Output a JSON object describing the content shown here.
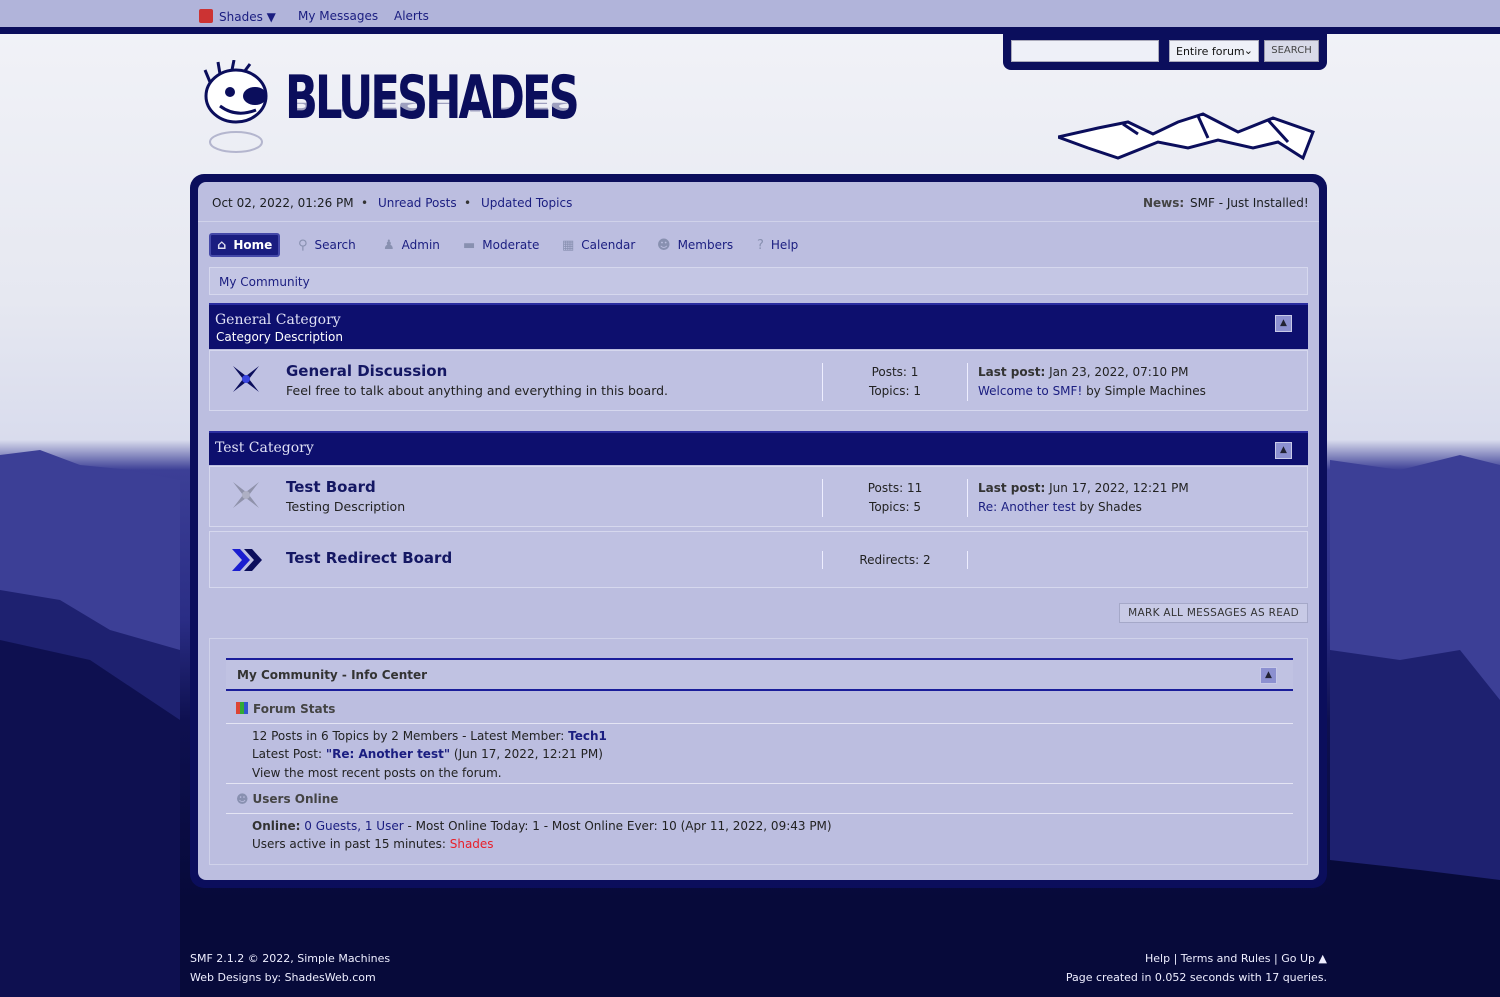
{
  "topbar": {
    "user_label": "Shades ▼",
    "messages": "My Messages",
    "alerts": "Alerts"
  },
  "search": {
    "placeholder": "",
    "scope": "Entire forum",
    "button": "SEARCH"
  },
  "logo": {
    "text": "BLUESHADES"
  },
  "upper": {
    "datetime": "Oct 02, 2022, 01:26 PM",
    "unread": "Unread Posts",
    "updated": "Updated Topics",
    "news_label": "News:",
    "news_text": "SMF - Just Installed!"
  },
  "nav": [
    {
      "label": "Home",
      "icon": "home-icon"
    },
    {
      "label": "Search",
      "icon": "search-icon"
    },
    {
      "label": "Admin",
      "icon": "admin-icon"
    },
    {
      "label": "Moderate",
      "icon": "moderate-icon"
    },
    {
      "label": "Calendar",
      "icon": "calendar-icon"
    },
    {
      "label": "Members",
      "icon": "members-icon"
    },
    {
      "label": "Help",
      "icon": "help-icon"
    }
  ],
  "breadcrumb": "My Community",
  "categories": [
    {
      "title": "General Category",
      "description": "Category Description",
      "boards": [
        {
          "name": "General Discussion",
          "description": "Feel free to talk about anything and everything in this board.",
          "posts": "Posts: 1",
          "topics": "Topics: 1",
          "last_label": "Last post:",
          "last_date": " Jan 23, 2022, 07:10 PM",
          "last_topic": "Welcome to SMF!",
          "last_by": " by Simple Machines"
        }
      ]
    },
    {
      "title": "Test Category",
      "description": "",
      "boards": [
        {
          "name": "Test Board",
          "description": "Testing Description",
          "posts": "Posts: 11",
          "topics": "Topics: 5",
          "last_label": "Last post:",
          "last_date": " Jun 17, 2022, 12:21 PM",
          "last_topic": "Re: Another test",
          "last_by": " by Shades"
        },
        {
          "name": "Test Redirect Board",
          "redirects": "Redirects: 2"
        }
      ]
    }
  ],
  "mark_read": "MARK ALL MESSAGES AS READ",
  "info_center": {
    "title": "My Community - Info Center",
    "stats_title": "Forum Stats",
    "stats_line1_pre": "12 Posts in 6 Topics by 2 Members - Latest Member: ",
    "stats_latest_member": "Tech1",
    "stats_line2_pre": "Latest Post: ",
    "stats_latest_post": "\"Re: Another test\"",
    "stats_line2_post": " (Jun 17, 2022, 12:21 PM)",
    "stats_line3": "View the most recent posts on the forum.",
    "online_title": "Users Online",
    "online_label": "Online:",
    "online_guests": " 0 Guests, 1 User",
    "online_rest": " - Most Online Today: 1 -  Most Online Ever: 10 (Apr 11, 2022, 09:43 PM)",
    "active_pre": "Users active in past 15 minutes: ",
    "active_user": "Shades",
    "active_user_color": "#e8202a"
  },
  "footer": {
    "left1": "SMF 2.1.2 © 2022, Simple Machines",
    "left2": "Web Designs by: ShadesWeb.com",
    "help": "Help",
    "terms": "Terms and Rules",
    "goup": "Go Up ▲",
    "stats": "Page created in 0.052 seconds with 17 queries."
  },
  "colors": {
    "primary": "#0b0e5c",
    "panel": "#bcbee0",
    "link": "#1a1d80"
  }
}
